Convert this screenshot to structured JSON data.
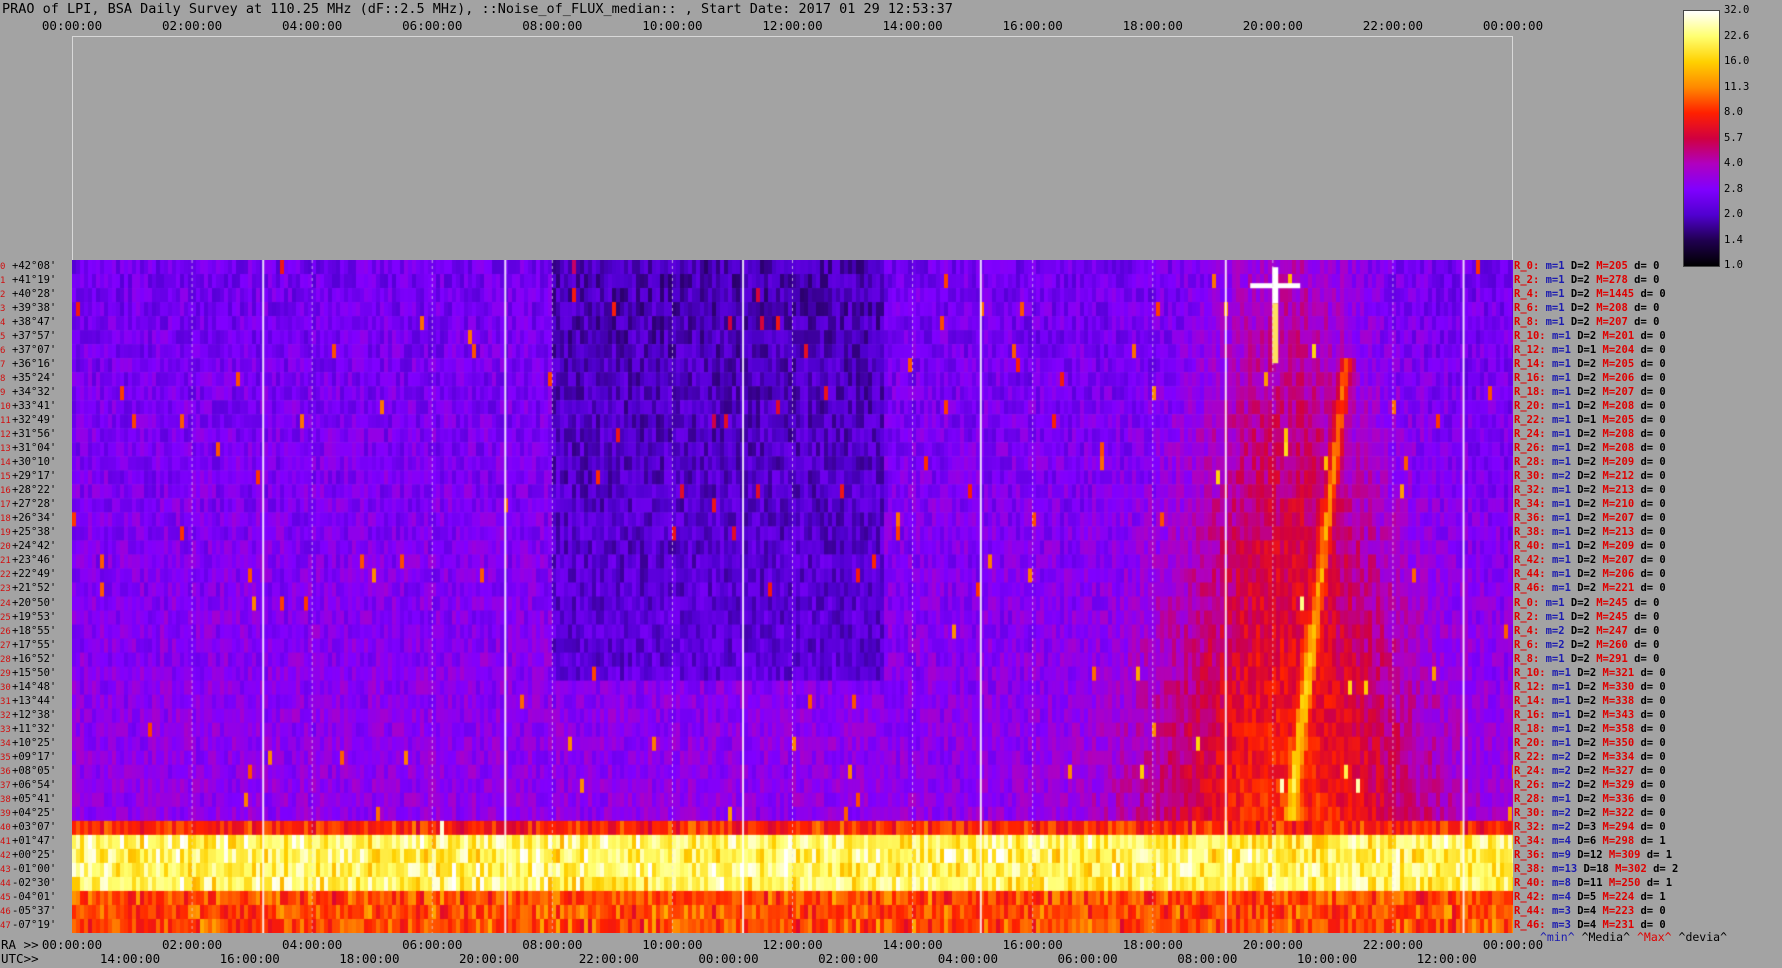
{
  "title": "PRAO of LPI, BSA Daily Survey at 110.25 MHz (dF::2.5 MHz), ::Noise_of_FLUX_median:: , Start Date: 2017 01 29 12:53:37",
  "axes": {
    "top_ticks": [
      "00:00:00",
      "02:00:00",
      "04:00:00",
      "06:00:00",
      "08:00:00",
      "10:00:00",
      "12:00:00",
      "14:00:00",
      "16:00:00",
      "18:00:00",
      "20:00:00",
      "22:00:00",
      "00:00:00"
    ],
    "ra_prefix": "RA >>",
    "ra_ticks": [
      "00:00:00",
      "02:00:00",
      "04:00:00",
      "06:00:00",
      "08:00:00",
      "10:00:00",
      "12:00:00",
      "14:00:00",
      "16:00:00",
      "18:00:00",
      "20:00:00",
      "22:00:00",
      "00:00:00"
    ],
    "utc_prefix": "UTC>>",
    "utc_ticks": [
      "14:00:00",
      "16:00:00",
      "18:00:00",
      "20:00:00",
      "22:00:00",
      "00:00:00",
      "02:00:00",
      "04:00:00",
      "06:00:00",
      "08:00:00",
      "10:00:00",
      "12:00:00"
    ]
  },
  "colorbar": {
    "labels": [
      "32.0",
      "22.6",
      "16.0",
      "11.3",
      "8.0",
      "5.7",
      "4.0",
      "2.8",
      "2.0",
      "1.4",
      "1.0"
    ],
    "colors": [
      "#ffffff",
      "#ffff70",
      "#ffd000",
      "#ff8800",
      "#ff2000",
      "#d00040",
      "#b000c0",
      "#8000ff",
      "#5000d0",
      "#200050",
      "#000000"
    ]
  },
  "declinations": [
    "+42°08'",
    "+41°19'",
    "+40°28'",
    "+39°38'",
    "+38°47'",
    "+37°57'",
    "+37°07'",
    "+36°16'",
    "+35°24'",
    "+34°32'",
    "+33°41'",
    "+32°49'",
    "+31°56'",
    "+31°04'",
    "+30°10'",
    "+29°17'",
    "+28°22'",
    "+27°28'",
    "+26°34'",
    "+25°38'",
    "+24°42'",
    "+23°46'",
    "+22°49'",
    "+21°52'",
    "+20°50'",
    "+19°53'",
    "+18°55'",
    "+17°55'",
    "+16°52'",
    "+15°50'",
    "+14°48'",
    "+13°44'",
    "+12°38'",
    "+11°32'",
    "+10°25'",
    "+09°17'",
    "+08°05'",
    "+06°54'",
    "+05°41'",
    "+04°25'",
    "+03°07'",
    "+01°47'",
    "+00°25'",
    "-01°00'",
    "-02°30'",
    "-04°01'",
    "-05°37'",
    "-07°19'"
  ],
  "stats": [
    {
      "r": "R_0:",
      "m": "m=1",
      "d": "D=2",
      "M": "M=205",
      "dv": "d= 0"
    },
    {
      "r": "R_2:",
      "m": "m=1",
      "d": "D=2",
      "M": "M=278",
      "dv": "d= 0"
    },
    {
      "r": "R_4:",
      "m": "m=1",
      "d": "D=2",
      "M": "M=1445",
      "dv": "d= 0"
    },
    {
      "r": "R_6:",
      "m": "m=1",
      "d": "D=2",
      "M": "M=208",
      "dv": "d= 0"
    },
    {
      "r": "R_8:",
      "m": "m=1",
      "d": "D=2",
      "M": "M=207",
      "dv": "d= 0"
    },
    {
      "r": "R_10:",
      "m": "m=1",
      "d": "D=2",
      "M": "M=201",
      "dv": "d= 0"
    },
    {
      "r": "R_12:",
      "m": "m=1",
      "d": "D=1",
      "M": "M=204",
      "dv": "d= 0"
    },
    {
      "r": "R_14:",
      "m": "m=1",
      "d": "D=2",
      "M": "M=205",
      "dv": "d= 0"
    },
    {
      "r": "R_16:",
      "m": "m=1",
      "d": "D=2",
      "M": "M=206",
      "dv": "d= 0"
    },
    {
      "r": "R_18:",
      "m": "m=1",
      "d": "D=2",
      "M": "M=207",
      "dv": "d= 0"
    },
    {
      "r": "R_20:",
      "m": "m=1",
      "d": "D=2",
      "M": "M=208",
      "dv": "d= 0"
    },
    {
      "r": "R_22:",
      "m": "m=1",
      "d": "D=1",
      "M": "M=205",
      "dv": "d= 0"
    },
    {
      "r": "R_24:",
      "m": "m=1",
      "d": "D=2",
      "M": "M=208",
      "dv": "d= 0"
    },
    {
      "r": "R_26:",
      "m": "m=1",
      "d": "D=2",
      "M": "M=208",
      "dv": "d= 0"
    },
    {
      "r": "R_28:",
      "m": "m=1",
      "d": "D=2",
      "M": "M=209",
      "dv": "d= 0"
    },
    {
      "r": "R_30:",
      "m": "m=2",
      "d": "D=2",
      "M": "M=212",
      "dv": "d= 0"
    },
    {
      "r": "R_32:",
      "m": "m=1",
      "d": "D=2",
      "M": "M=213",
      "dv": "d= 0"
    },
    {
      "r": "R_34:",
      "m": "m=1",
      "d": "D=2",
      "M": "M=210",
      "dv": "d= 0"
    },
    {
      "r": "R_36:",
      "m": "m=1",
      "d": "D=2",
      "M": "M=207",
      "dv": "d= 0"
    },
    {
      "r": "R_38:",
      "m": "m=1",
      "d": "D=2",
      "M": "M=213",
      "dv": "d= 0"
    },
    {
      "r": "R_40:",
      "m": "m=1",
      "d": "D=2",
      "M": "M=209",
      "dv": "d= 0"
    },
    {
      "r": "R_42:",
      "m": "m=1",
      "d": "D=2",
      "M": "M=207",
      "dv": "d= 0"
    },
    {
      "r": "R_44:",
      "m": "m=1",
      "d": "D=2",
      "M": "M=206",
      "dv": "d= 0"
    },
    {
      "r": "R_46:",
      "m": "m=1",
      "d": "D=2",
      "M": "M=221",
      "dv": "d= 0"
    },
    {
      "r": "R_0:",
      "m": "m=1",
      "d": "D=2",
      "M": "M=245",
      "dv": "d= 0"
    },
    {
      "r": "R_2:",
      "m": "m=1",
      "d": "D=2",
      "M": "M=245",
      "dv": "d= 0"
    },
    {
      "r": "R_4:",
      "m": "m=2",
      "d": "D=2",
      "M": "M=247",
      "dv": "d= 0"
    },
    {
      "r": "R_6:",
      "m": "m=2",
      "d": "D=2",
      "M": "M=260",
      "dv": "d= 0"
    },
    {
      "r": "R_8:",
      "m": "m=1",
      "d": "D=2",
      "M": "M=291",
      "dv": "d= 0"
    },
    {
      "r": "R_10:",
      "m": "m=1",
      "d": "D=2",
      "M": "M=321",
      "dv": "d= 0"
    },
    {
      "r": "R_12:",
      "m": "m=1",
      "d": "D=2",
      "M": "M=330",
      "dv": "d= 0"
    },
    {
      "r": "R_14:",
      "m": "m=1",
      "d": "D=2",
      "M": "M=338",
      "dv": "d= 0"
    },
    {
      "r": "R_16:",
      "m": "m=1",
      "d": "D=2",
      "M": "M=343",
      "dv": "d= 0"
    },
    {
      "r": "R_18:",
      "m": "m=1",
      "d": "D=2",
      "M": "M=358",
      "dv": "d= 0"
    },
    {
      "r": "R_20:",
      "m": "m=1",
      "d": "D=2",
      "M": "M=350",
      "dv": "d= 0"
    },
    {
      "r": "R_22:",
      "m": "m=2",
      "d": "D=2",
      "M": "M=334",
      "dv": "d= 0"
    },
    {
      "r": "R_24:",
      "m": "m=2",
      "d": "D=2",
      "M": "M=327",
      "dv": "d= 0"
    },
    {
      "r": "R_26:",
      "m": "m=2",
      "d": "D=2",
      "M": "M=329",
      "dv": "d= 0"
    },
    {
      "r": "R_28:",
      "m": "m=1",
      "d": "D=2",
      "M": "M=336",
      "dv": "d= 0"
    },
    {
      "r": "R_30:",
      "m": "m=2",
      "d": "D=2",
      "M": "M=322",
      "dv": "d= 0"
    },
    {
      "r": "R_32:",
      "m": "m=2",
      "d": "D=3",
      "M": "M=294",
      "dv": "d= 0"
    },
    {
      "r": "R_34:",
      "m": "m=4",
      "d": "D=6",
      "M": "M=298",
      "dv": "d= 1"
    },
    {
      "r": "R_36:",
      "m": "m=9",
      "d": "D=12",
      "M": "M=309",
      "dv": "d= 1"
    },
    {
      "r": "R_38:",
      "m": "m=13",
      "d": "D=18",
      "M": "M=302",
      "dv": "d= 2"
    },
    {
      "r": "R_40:",
      "m": "m=8",
      "d": "D=11",
      "M": "M=250",
      "dv": "d= 1"
    },
    {
      "r": "R_42:",
      "m": "m=4",
      "d": "D=5",
      "M": "M=224",
      "dv": "d= 1"
    },
    {
      "r": "R_44:",
      "m": "m=3",
      "d": "D=4",
      "M": "M=223",
      "dv": "d= 0"
    },
    {
      "r": "R_46:",
      "m": "m=3",
      "d": "D=4",
      "M": "M=231",
      "dv": "d= 0"
    }
  ],
  "stat_legend": {
    "min": "^min^",
    "media": "^Media^",
    "max": "^Max^",
    "devia": "^devia^"
  },
  "chart_data": {
    "type": "heatmap",
    "title": "PRAO of LPI, BSA Daily Survey at 110.25 MHz (dF::2.5 MHz), ::Noise_of_FLUX_median:: , Start Date: 2017 01 29 12:53:37",
    "x_axis": "RA 00:00:00 to 24:00:00 (top and bottom); UTC 12:53:37 onward",
    "y_axis": "Declination (48 beams, +42°08' to -07°19')",
    "color_scale": "log",
    "color_range": [
      1.0,
      32.0
    ],
    "features": [
      {
        "description": "bright horizontal band",
        "declination_range": [
          "+01°47'",
          "-02°30'"
        ],
        "level": "~16-32"
      },
      {
        "description": "intense source (Cas A region)",
        "ra": "20:00:00",
        "declination": "+40°28'",
        "level": "32"
      },
      {
        "description": "galactic plane emission",
        "ra_range": [
          "17:00:00",
          "21:00:00"
        ],
        "level": "~4-8"
      }
    ]
  }
}
